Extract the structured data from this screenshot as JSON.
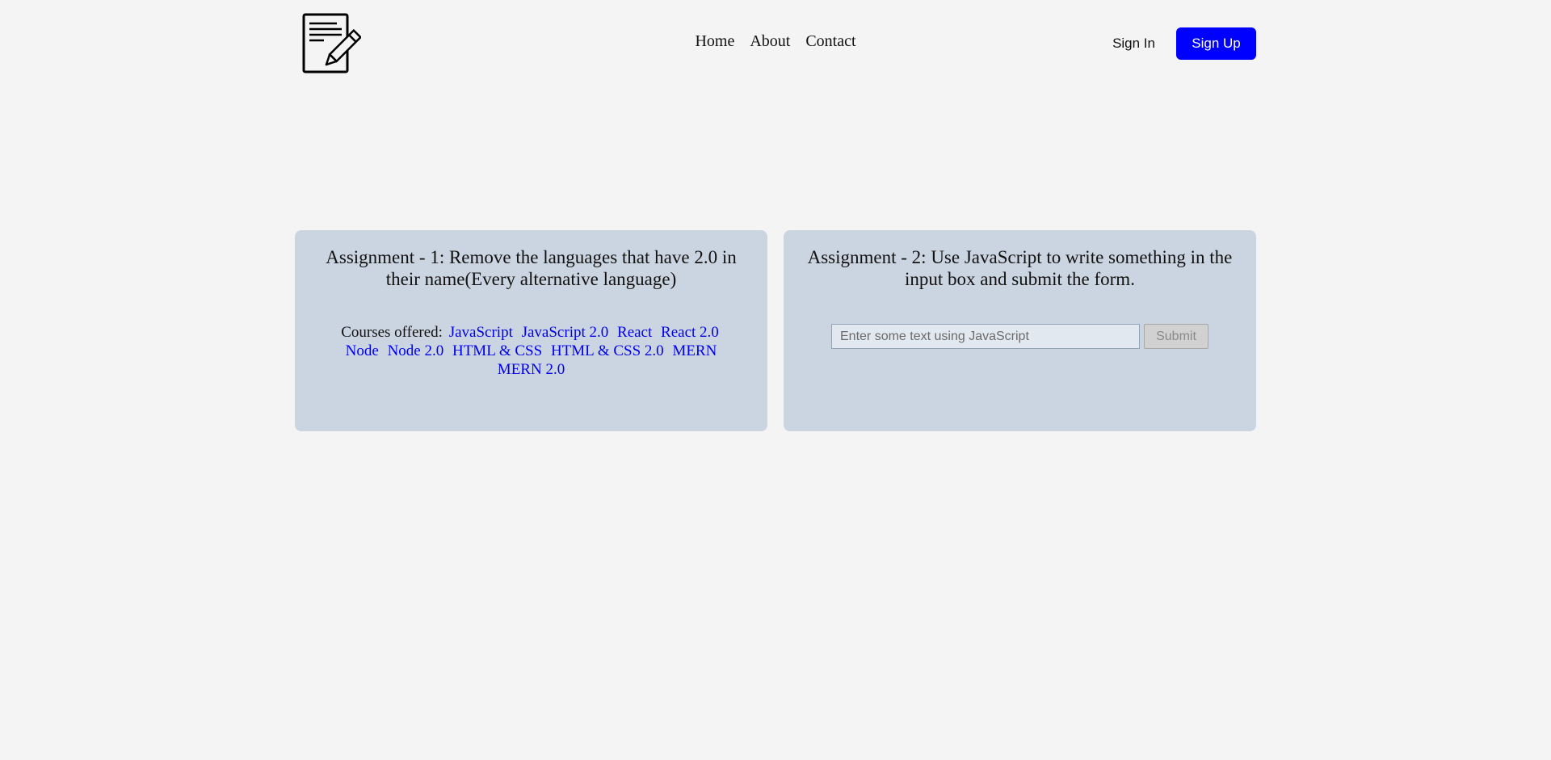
{
  "header": {
    "logo_icon": "notepad-pencil-icon",
    "nav": [
      {
        "label": "Home"
      },
      {
        "label": "About"
      },
      {
        "label": "Contact"
      }
    ],
    "sign_in": "Sign In",
    "sign_up": "Sign Up",
    "sign_up_color": "#0000ff"
  },
  "assignment1": {
    "title": "Assignment - 1: Remove the languages that have 2.0 in their name(Every alternative language)",
    "courses_label": "Courses offered:",
    "courses": [
      "JavaScript",
      "JavaScript 2.0",
      "React",
      "React 2.0",
      "Node",
      "Node 2.0",
      "HTML & CSS",
      "HTML & CSS 2.0",
      "MERN",
      "MERN 2.0"
    ]
  },
  "assignment2": {
    "title": "Assignment - 2: Use JavaScript to write something in the input box and submit the form.",
    "input_value": "",
    "input_placeholder": "Enter some text using JavaScript",
    "submit_label": "Submit"
  },
  "colors": {
    "page_background": "#f4f4f4",
    "card_background": "#cbd5e1",
    "link": "#0000ee"
  }
}
